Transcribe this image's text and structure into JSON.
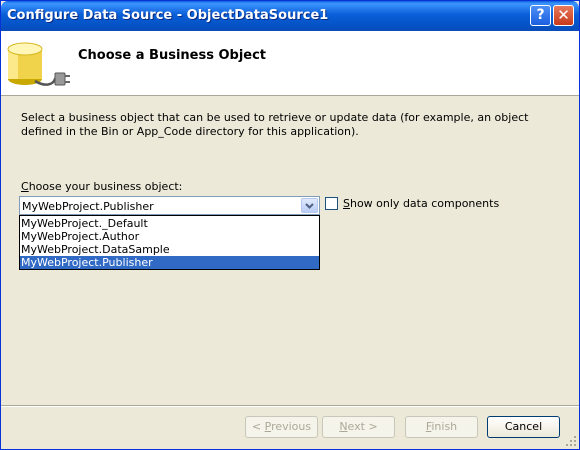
{
  "window": {
    "title": "Configure Data Source - ObjectDataSource1"
  },
  "titlebar": {
    "help_label": "?",
    "close_label": "✕"
  },
  "header": {
    "title": "Choose a Business Object",
    "icon": "database-plug-icon"
  },
  "description": "Select a business object that can be used to retrieve or update data (for example, an object defined in the Bin or App_Code directory for this application).",
  "business_object": {
    "label_prefix": "C",
    "label_rest": "hoose your business object:",
    "selected": "MyWebProject.Publisher",
    "options": [
      "MyWebProject._Default",
      "MyWebProject.Author",
      "MyWebProject.DataSample",
      "MyWebProject.Publisher"
    ],
    "highlighted_index": 3
  },
  "show_only_checkbox": {
    "label_prefix": "S",
    "label_rest": "how only data components",
    "checked": false
  },
  "buttons": {
    "previous": {
      "pre": "< ",
      "mn": "P",
      "post": "revious"
    },
    "next": {
      "pre": "",
      "mn": "N",
      "post": "ext >"
    },
    "finish": {
      "pre": "",
      "mn": "F",
      "post": "inish"
    },
    "cancel": "Cancel"
  }
}
